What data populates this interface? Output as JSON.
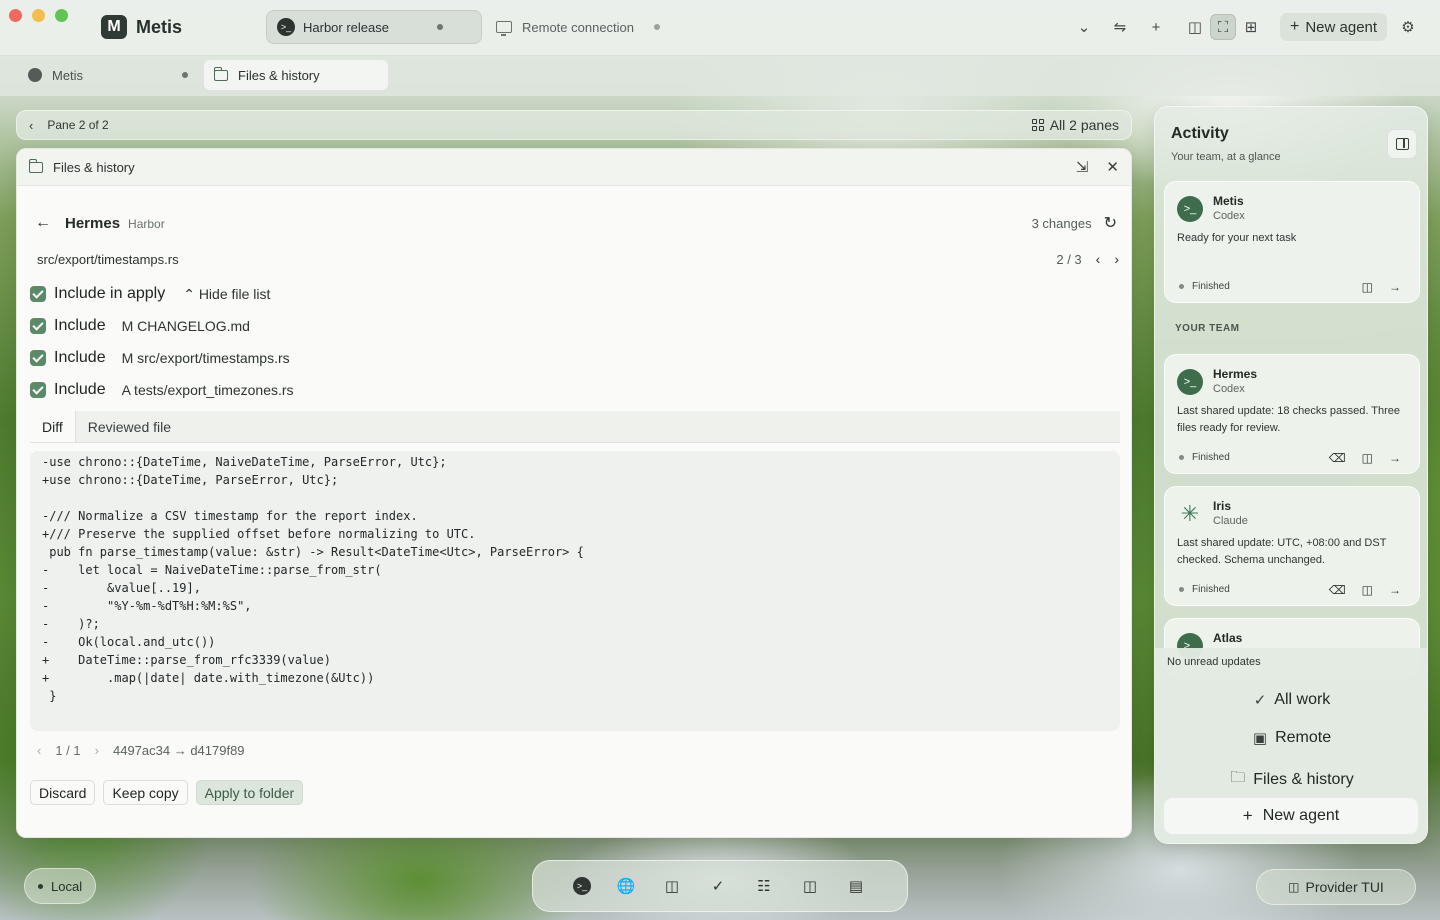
{
  "window": {
    "app_name": "Metis",
    "logo_letter": "M",
    "tabs": [
      {
        "label": "Harbor release",
        "active": true
      },
      {
        "label": "Remote connection",
        "active": false
      }
    ],
    "new_agent_label": "New agent"
  },
  "subtabs": [
    {
      "label": "Metis"
    },
    {
      "label": "Files & history",
      "active": true
    }
  ],
  "pane_bar": {
    "label": "Pane 2 of 2",
    "all_panes_label": "All 2 panes"
  },
  "panel": {
    "title": "Files & history",
    "agent_name": "Hermes",
    "project": "Harbor",
    "changes": "3 changes",
    "file_path": "src/export/timestamps.rs",
    "file_pager": "2 / 3",
    "include_apply_label": "Include in apply",
    "hide_file_list_label": "Hide file list",
    "files": [
      {
        "include_label": "Include",
        "name": "M CHANGELOG.md"
      },
      {
        "include_label": "Include",
        "name": "M src/export/timestamps.rs"
      },
      {
        "include_label": "Include",
        "name": "A tests/export_timezones.rs"
      }
    ],
    "tabs": [
      "Diff",
      "Reviewed file"
    ],
    "diff_lines": [
      "-use chrono::{DateTime, NaiveDateTime, ParseError, Utc};",
      "+use chrono::{DateTime, ParseError, Utc};",
      "",
      "-/// Normalize a CSV timestamp for the report index.",
      "+/// Preserve the supplied offset before normalizing to UTC.",
      " pub fn parse_timestamp(value: &str) -> Result<DateTime<Utc>, ParseError> {",
      "-    let local = NaiveDateTime::parse_from_str(",
      "-        &value[..19],",
      "-        \"%Y-%m-%dT%H:%M:%S\",",
      "-    )?;",
      "-    Ok(local.and_utc())",
      "+    DateTime::parse_from_rfc3339(value)",
      "+        .map(|date| date.with_timezone(&Utc))",
      " }"
    ],
    "hunk_pager": "1 / 1",
    "commit_range": "4497ac34 → d4179f89",
    "actions": {
      "discard": "Discard",
      "keep_copy": "Keep copy",
      "apply": "Apply to folder"
    }
  },
  "activity": {
    "title": "Activity",
    "subtitle": "Your team, at a glance",
    "team_label": "YOUR TEAM",
    "agents": [
      {
        "name": "Metis",
        "model": "Codex",
        "message": "Ready for your next task",
        "status": "Finished"
      },
      {
        "name": "Hermes",
        "model": "Codex",
        "message": "Last shared update: 18 checks passed. Three files ready for review.",
        "status": "Finished"
      },
      {
        "name": "Iris",
        "model": "Claude",
        "message": "Last shared update: UTC, +08:00 and DST checked. Schema unchanged.",
        "status": "Finished"
      },
      {
        "name": "Atlas"
      }
    ],
    "unread": "No unread updates",
    "links": [
      "All work",
      "Remote",
      "Files & history"
    ],
    "new_agent": "New agent"
  },
  "bottom": {
    "local_label": "Local",
    "provider_label": "Provider TUI"
  },
  "colors": {
    "accent_green": "#5c8a66",
    "avatar_green": "#3e6c4d"
  }
}
